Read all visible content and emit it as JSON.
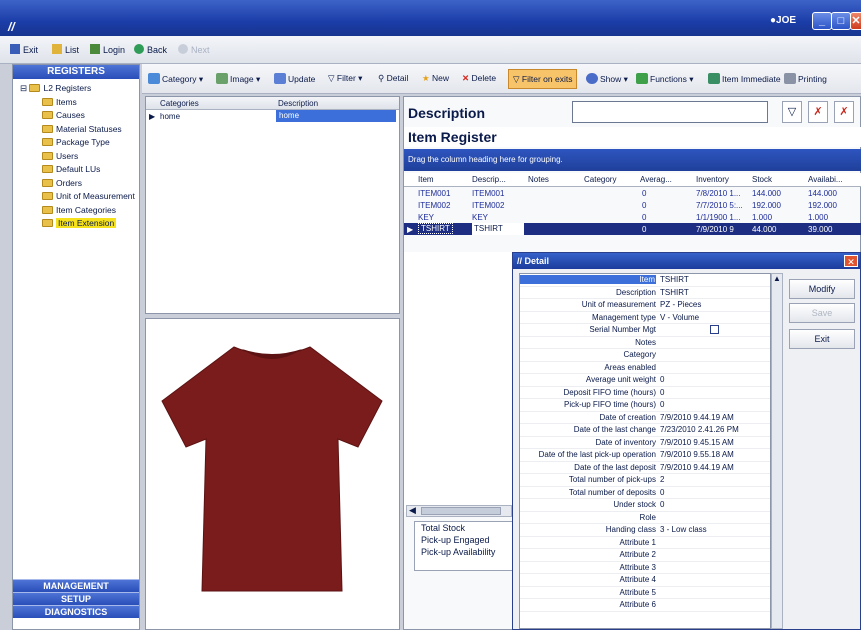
{
  "window": {
    "user": "JOE",
    "min_label": "_",
    "max_label": "□",
    "close_label": "✕"
  },
  "nav": {
    "exit": "Exit",
    "list": "List",
    "login": "Login",
    "back": "Back",
    "next": "Next"
  },
  "sidebar": {
    "header": "REGISTERS",
    "root": "L2 Registers",
    "items": [
      "Items",
      "Causes",
      "Material Statuses",
      "Package Type",
      "Users",
      "Default LUs",
      "Orders",
      "Unit of Measurement",
      "Item Categories",
      "Item Extension"
    ],
    "footer": [
      "MANAGEMENT",
      "SETUP",
      "DIAGNOSTICS"
    ]
  },
  "toolbar": {
    "category": "Category",
    "image": "Image",
    "update": "Update",
    "filter": "Filter",
    "detail": "Detail",
    "new": "New",
    "delete": "Delete",
    "filter_on_exits": "Filter on exits",
    "show": "Show",
    "functions": "Functions",
    "item_immediate": "Item Immediate",
    "printing": "Printing"
  },
  "categories": {
    "headers": [
      "Categories",
      "Description"
    ],
    "rows": [
      {
        "category": "home",
        "description": "home"
      }
    ]
  },
  "main": {
    "description_label": "Description",
    "register_title": "Item Register",
    "group_hint": "Drag the column heading here for grouping.",
    "columns": [
      "Item",
      "Descrip...",
      "Notes",
      "Category",
      "Averag...",
      "Inventory",
      "Stock",
      "Availabi..."
    ],
    "rows": [
      [
        "ITEM001",
        "ITEM001",
        "",
        "",
        "0",
        "7/8/2010 1...",
        "144.000",
        "144.000"
      ],
      [
        "ITEM002",
        "ITEM002",
        "",
        "",
        "0",
        "7/7/2010 5:...",
        "192.000",
        "192.000"
      ],
      [
        "KEY",
        "KEY",
        "",
        "",
        "0",
        "1/1/1900 1...",
        "1.000",
        "1.000"
      ],
      [
        "TSHIRT",
        "TSHIRT",
        "",
        "",
        "0",
        "7/9/2010 9",
        "44.000",
        "39.000"
      ]
    ],
    "totals": [
      "Total Stock",
      "Pick-up Engaged",
      "Pick-up Availability"
    ]
  },
  "detail": {
    "title": "Detail",
    "rows": [
      [
        "Item",
        "TSHIRT"
      ],
      [
        "Description",
        "TSHIRT"
      ],
      [
        "Unit of measurement",
        "PZ - Pieces"
      ],
      [
        "Management type",
        "V - Volume"
      ],
      [
        "Serial Number Mgt",
        ""
      ],
      [
        "Notes",
        ""
      ],
      [
        "Category",
        ""
      ],
      [
        "Areas enabled",
        ""
      ],
      [
        "Average unit weight",
        "0"
      ],
      [
        "Deposit FIFO time (hours)",
        "0"
      ],
      [
        "Pick-up FIFO time (hours)",
        "0"
      ],
      [
        "Date of creation",
        "7/9/2010 9.44.19 AM"
      ],
      [
        "Date of the last change",
        "7/23/2010 2.41.26 PM"
      ],
      [
        "Date of inventory",
        "7/9/2010 9.45.15 AM"
      ],
      [
        "Date of the last pick-up operation",
        "7/9/2010 9.55.18 AM"
      ],
      [
        "Date of the last deposit",
        "7/9/2010 9.44.19 AM"
      ],
      [
        "Total number of pick-ups",
        "2"
      ],
      [
        "Total number of deposits",
        "0"
      ],
      [
        "Under stock",
        "0"
      ],
      [
        "Role",
        ""
      ],
      [
        "Handing class",
        "3 - Low class"
      ],
      [
        "Attribute 1",
        ""
      ],
      [
        "Attribute 2",
        ""
      ],
      [
        "Attribute 3",
        ""
      ],
      [
        "Attribute 4",
        ""
      ],
      [
        "Attribute 5",
        ""
      ],
      [
        "Attribute 6",
        ""
      ]
    ],
    "modify": "Modify",
    "save": "Save",
    "exit": "Exit"
  },
  "colors": {
    "accent": "#2a4eb8",
    "selection": "#3c6fd9",
    "tshirt": "#7a1c1c",
    "highlight": "#f5e21c"
  }
}
